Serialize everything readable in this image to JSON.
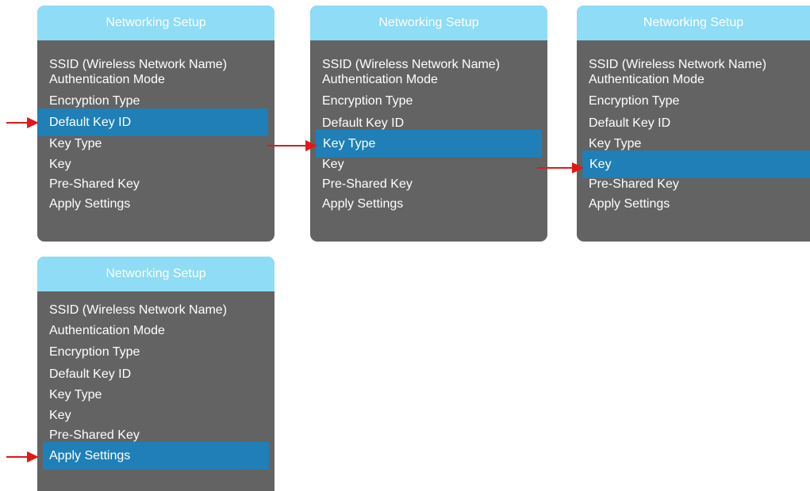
{
  "panels": [
    {
      "title": "Networking Setup",
      "items": [
        "SSID (Wireless Network Name)",
        "Authentication Mode",
        "Encryption Type",
        "Default Key ID",
        "Key Type",
        "Key",
        "Pre-Shared Key",
        "Apply Settings"
      ],
      "selected_index": 3
    },
    {
      "title": "Networking Setup",
      "items": [
        "SSID (Wireless Network Name)",
        "Authentication Mode",
        "Encryption Type",
        "Default Key ID",
        "Key Type",
        "Key",
        "Pre-Shared Key",
        "Apply Settings"
      ],
      "selected_index": 4
    },
    {
      "title": "Networking Setup",
      "items": [
        "SSID (Wireless Network Name)",
        "Authentication Mode",
        "Encryption Type",
        "Default Key ID",
        "Key Type",
        "Key",
        "Pre-Shared Key",
        "Apply Settings"
      ],
      "selected_index": 5
    },
    {
      "title": "Networking Setup",
      "items": [
        "SSID (Wireless Network Name)",
        "Authentication Mode",
        "Encryption Type",
        "Default Key ID",
        "Key Type",
        "Key",
        "Pre-Shared Key",
        "Apply Settings"
      ],
      "selected_index": 7
    }
  ],
  "colors": {
    "header_background": "#8edcf5",
    "panel_background": "#636363",
    "selection_background": "#1f7fb6",
    "arrow": "#e01818"
  }
}
